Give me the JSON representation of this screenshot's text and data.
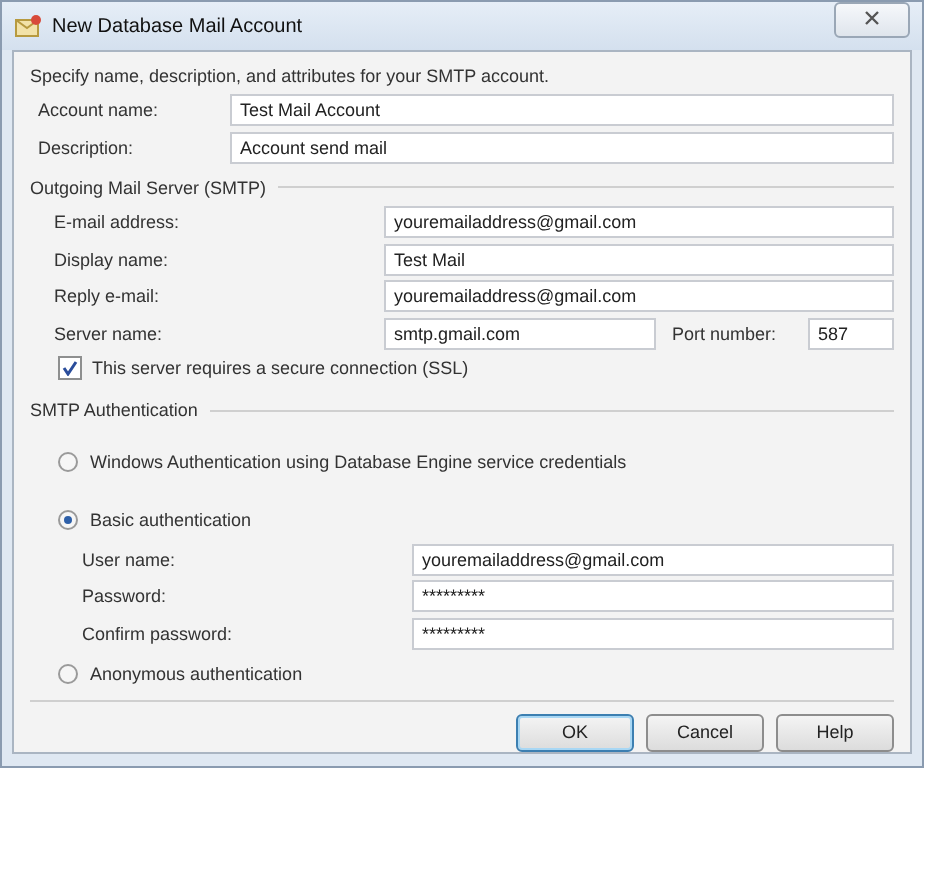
{
  "window": {
    "title": "New Database Mail Account"
  },
  "intro": "Specify name, description, and attributes for your SMTP account.",
  "account_fields": [
    {
      "label": "Account name:",
      "value": "Test Mail Account"
    },
    {
      "label": "Description:",
      "value": "Account send mail"
    }
  ],
  "outgoing_server": {
    "heading": "Outgoing Mail Server (SMTP)",
    "fields": [
      {
        "label": "E-mail address:",
        "value": "youremailaddress@gmail.com"
      },
      {
        "label": "Display name:",
        "value": "Test Mail"
      },
      {
        "label": "Reply e-mail:",
        "value": "youremailaddress@gmail.com"
      }
    ],
    "server_name": {
      "label": "Server name:",
      "value": "smtp.gmail.com"
    },
    "port": {
      "label": "Port number:",
      "value": "587"
    },
    "ssl": {
      "label": "This server requires a secure connection (SSL)",
      "checked": true
    }
  },
  "smtp_authentication": {
    "heading": "SMTP Authentication",
    "options": [
      {
        "label": "Windows Authentication using Database Engine service credentials",
        "selected": false
      },
      {
        "label": "Basic authentication",
        "selected": true,
        "fields": [
          {
            "label": "User name:",
            "value": "youremailaddress@gmail.com"
          },
          {
            "label": "Password:",
            "value": "*********"
          },
          {
            "label": "Confirm password:",
            "value": "*********"
          }
        ]
      },
      {
        "label": "Anonymous authentication",
        "selected": false
      }
    ]
  },
  "buttons": [
    {
      "label": "OK",
      "default": true
    },
    {
      "label": "Cancel",
      "default": false
    },
    {
      "label": "Help",
      "default": false
    }
  ]
}
